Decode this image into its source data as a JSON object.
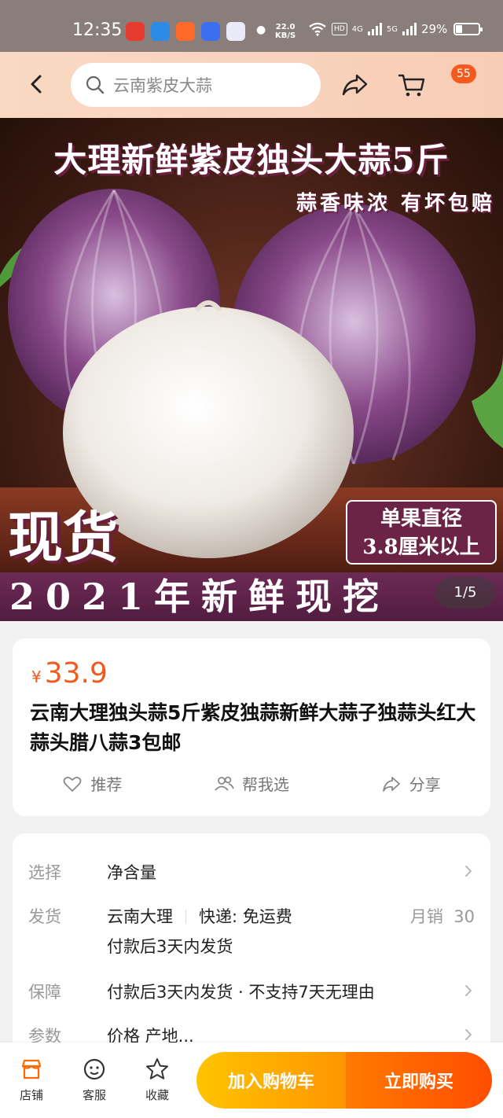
{
  "status_bar": {
    "time": "12:35",
    "speed_value": "22.0",
    "speed_unit": "KB/S",
    "hd_tag": "HD",
    "net1": "4G",
    "net2": "5G",
    "battery": "29%"
  },
  "header": {
    "search_text": "云南紫皮大蒜",
    "cart_badge": "55"
  },
  "product_image": {
    "title": "大理新鲜紫皮独头大蒜5斤",
    "subtitle": "蒜香味浓  有坏包赔",
    "stock_text": "现货",
    "size_line1": "单果直径",
    "size_line2": "3.8厘米以上",
    "bottom_text": "2021年新鲜现挖",
    "pager": "1/5"
  },
  "product": {
    "currency": "¥",
    "price": "33.9",
    "title": "云南大理独头蒜5斤紫皮独蒜新鲜大蒜子独蒜头红大蒜头腊八蒜3包邮"
  },
  "actions": {
    "recommend": "推荐",
    "help_choose": "帮我选",
    "share": "分享"
  },
  "info": {
    "select_label": "选择",
    "select_value": "净含量",
    "ship_label": "发货",
    "ship_origin": "云南大理",
    "ship_express": "快递: 免运费",
    "ship_monthly_label": "月销",
    "ship_monthly_value": "30",
    "ship_note": "付款后3天内发货",
    "guarantee_label": "保障",
    "guarantee_value": "付款后3天内发货 · 不支持7天无理由",
    "params_label": "参数",
    "params_value": "价格 产地..."
  },
  "bottom_bar": {
    "store": "店铺",
    "service": "客服",
    "favorite": "收藏",
    "add_cart": "加入购物车",
    "buy_now": "立即购买"
  }
}
